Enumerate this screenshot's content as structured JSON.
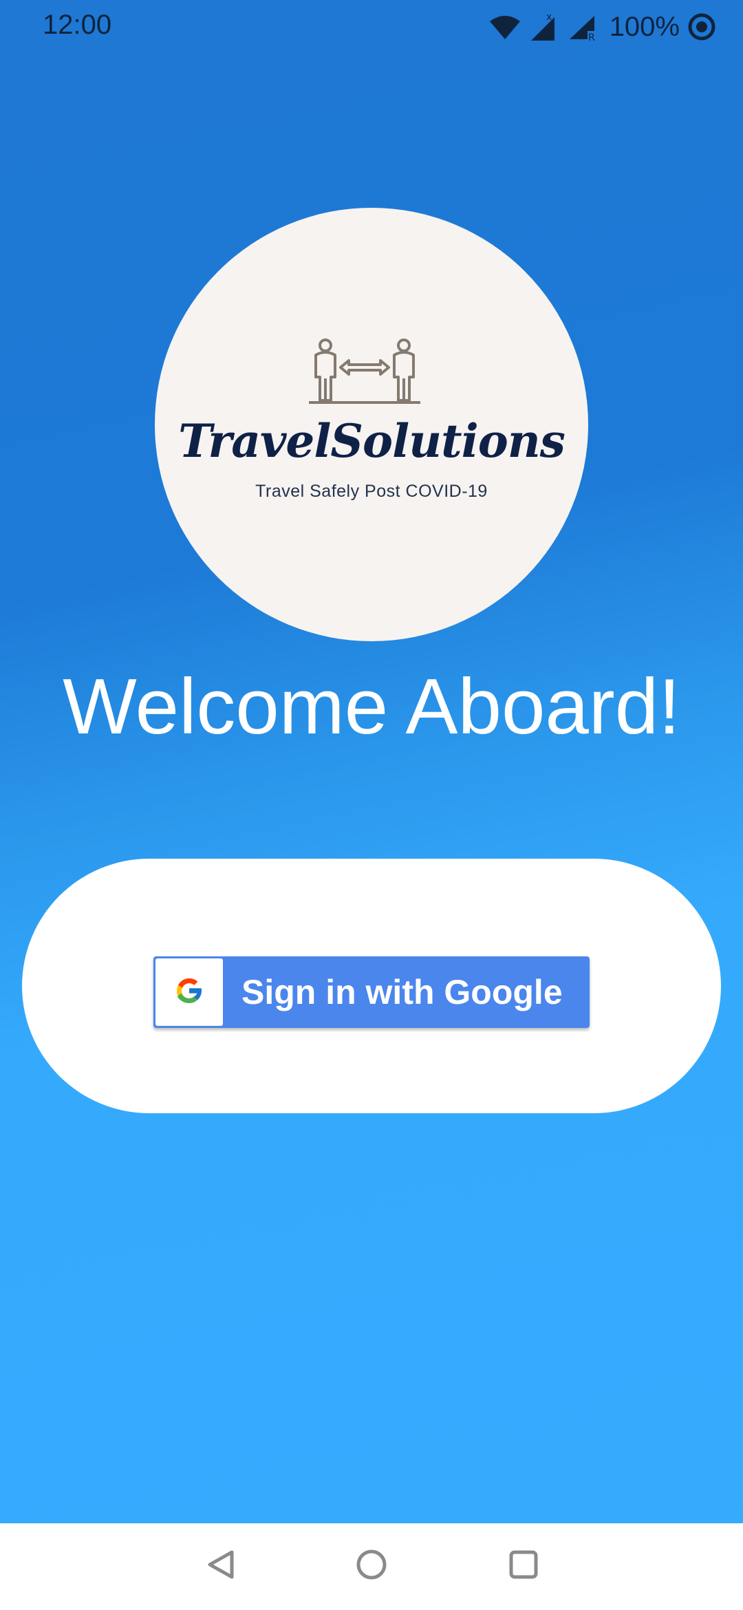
{
  "status_bar": {
    "time": "12:00",
    "battery": "100%",
    "icons": [
      "wifi-icon",
      "cell-signal-x-icon",
      "cell-signal-roaming-icon",
      "sync-ring-icon"
    ]
  },
  "logo": {
    "title": "TravelSolutions",
    "tagline": "Travel Safely Post COVID-19",
    "icon": "social-distancing-figures-icon",
    "background_color": "#f6f3f1"
  },
  "heading": "Welcome Aboard!",
  "signin": {
    "label": "Sign in with Google",
    "icon": "google-g-icon",
    "button_color": "#4a86ec"
  },
  "nav_bar": {
    "items": [
      "back-icon",
      "home-icon",
      "recents-icon"
    ]
  },
  "colors": {
    "gradient_top": "#1e78d4",
    "gradient_bottom": "#36abff",
    "card": "#ffffff"
  }
}
